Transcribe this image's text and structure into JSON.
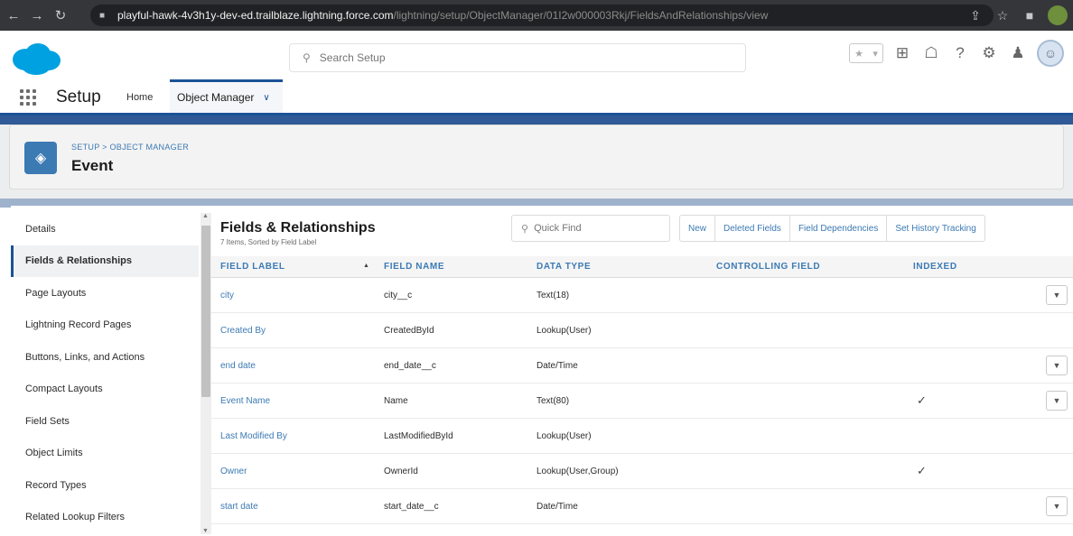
{
  "browser": {
    "url_host": "playful-hawk-4v3h1y-dev-ed.trailblaze.lightning.force.com",
    "url_path": "/lightning/setup/ObjectManager/01I2w000003Rkj/FieldsAndRelationships/view",
    "icons": [
      "back-icon",
      "forward-icon",
      "reload-icon",
      "lock-icon",
      "share-icon",
      "star-icon",
      "extensions-icon"
    ]
  },
  "header": {
    "search_placeholder": "Search Setup"
  },
  "app_nav": {
    "app_name": "Setup",
    "home_label": "Home",
    "object_manager_label": "Object Manager"
  },
  "page_header": {
    "breadcrumb": "SETUP > OBJECT MANAGER",
    "title": "Event"
  },
  "sidebar": {
    "items": [
      {
        "label": "Details",
        "active": false
      },
      {
        "label": "Fields & Relationships",
        "active": true
      },
      {
        "label": "Page Layouts",
        "active": false
      },
      {
        "label": "Lightning Record Pages",
        "active": false
      },
      {
        "label": "Buttons, Links, and Actions",
        "active": false
      },
      {
        "label": "Compact Layouts",
        "active": false
      },
      {
        "label": "Field Sets",
        "active": false
      },
      {
        "label": "Object Limits",
        "active": false
      },
      {
        "label": "Record Types",
        "active": false
      },
      {
        "label": "Related Lookup Filters",
        "active": false
      }
    ]
  },
  "content": {
    "title": "Fields & Relationships",
    "subtitle": "7 Items, Sorted by Field Label",
    "quick_find_placeholder": "Quick Find",
    "buttons": [
      "New",
      "Deleted Fields",
      "Field Dependencies",
      "Set History Tracking"
    ]
  },
  "table": {
    "columns": [
      "FIELD LABEL",
      "FIELD NAME",
      "DATA TYPE",
      "CONTROLLING FIELD",
      "INDEXED"
    ],
    "rows": [
      {
        "label": "city",
        "name": "city__c",
        "type": "Text(18)",
        "controlling": "",
        "indexed": false,
        "menu": true
      },
      {
        "label": "Created By",
        "name": "CreatedById",
        "type": "Lookup(User)",
        "controlling": "",
        "indexed": false,
        "menu": false
      },
      {
        "label": "end date",
        "name": "end_date__c",
        "type": "Date/Time",
        "controlling": "",
        "indexed": false,
        "menu": true
      },
      {
        "label": "Event Name",
        "name": "Name",
        "type": "Text(80)",
        "controlling": "",
        "indexed": true,
        "menu": true
      },
      {
        "label": "Last Modified By",
        "name": "LastModifiedById",
        "type": "Lookup(User)",
        "controlling": "",
        "indexed": false,
        "menu": false
      },
      {
        "label": "Owner",
        "name": "OwnerId",
        "type": "Lookup(User,Group)",
        "controlling": "",
        "indexed": true,
        "menu": false
      },
      {
        "label": "start date",
        "name": "start_date__c",
        "type": "Date/Time",
        "controlling": "",
        "indexed": false,
        "menu": true
      }
    ]
  },
  "colors": {
    "brand_blue": "#1b5297",
    "link_blue": "#3c7ab3",
    "salesforce_cloud": "#00a1e0"
  }
}
